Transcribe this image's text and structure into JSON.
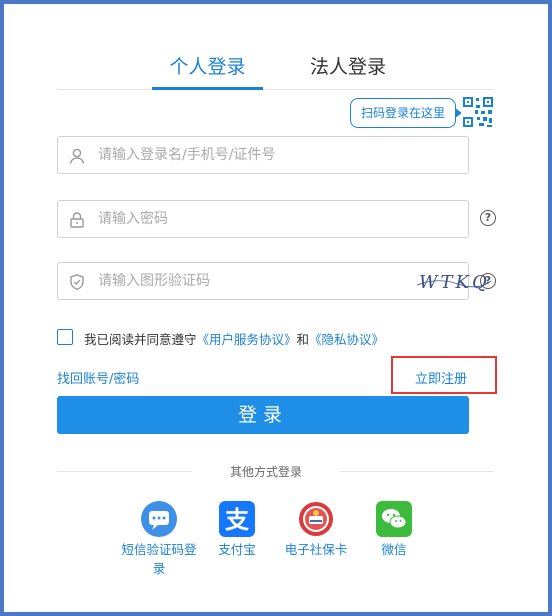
{
  "tabs": {
    "personal": "个人登录",
    "corporate": "法人登录"
  },
  "qr_hint": "扫码登录在这里",
  "fields": {
    "username_placeholder": "请输入登录名/手机号/证件号",
    "password_placeholder": "请输入密码",
    "captcha_placeholder": "请输入图形验证码",
    "captcha_text": "WTKQ"
  },
  "agreement": {
    "prefix": "我已阅读并同意遵守",
    "terms_link": "《用户服务协议》",
    "and": "和",
    "privacy_link": "《隐私协议》"
  },
  "links": {
    "recover": "找回账号/密码",
    "register": "立即注册"
  },
  "login_button": "登录",
  "other_methods": {
    "label": "其他方式登录",
    "options": [
      {
        "label": "短信验证码登录",
        "icon": "sms-icon"
      },
      {
        "label": "支付宝",
        "icon": "alipay-icon"
      },
      {
        "label": "电子社保卡",
        "icon": "social-security-card-icon"
      },
      {
        "label": "微信",
        "icon": "wechat-icon"
      }
    ]
  },
  "colors": {
    "accent": "#1a82d6",
    "button": "#1e8ee6",
    "highlight": "#e53935",
    "background": "#4a78c4"
  }
}
